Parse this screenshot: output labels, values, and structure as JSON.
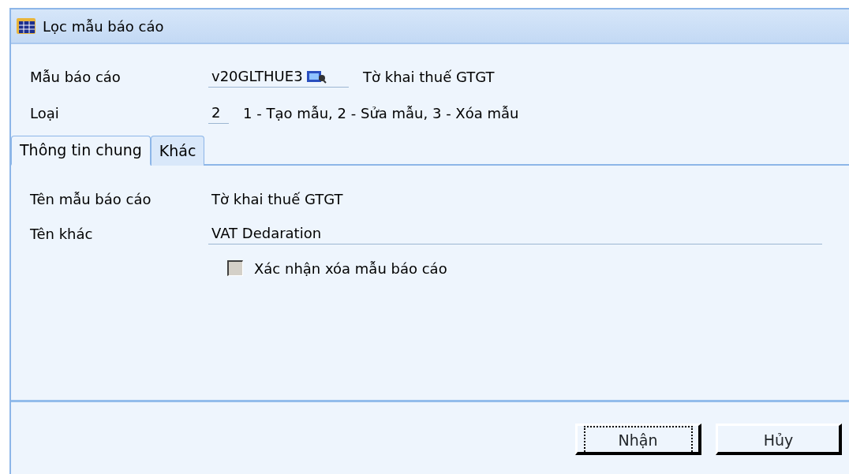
{
  "window": {
    "title": "Lọc mẫu báo cáo"
  },
  "header_fields": [
    {
      "label": "Mẫu báo cáo",
      "value": "v20GLTHUE3",
      "kind": "lookup",
      "note": "Tờ khai thuế GTGT"
    },
    {
      "label": "Loại",
      "value": "2",
      "kind": "short",
      "note": "1 - Tạo mẫu, 2 - Sửa mẫu, 3 - Xóa mẫu"
    }
  ],
  "tabs": [
    {
      "label": "Thông tin chung",
      "selected": true
    },
    {
      "label": "Khác",
      "selected": false
    }
  ],
  "fields": [
    {
      "label": "Tên mẫu báo cáo",
      "value": "Tờ khai thuế GTGT",
      "underlined": false
    },
    {
      "label": "Tên khác",
      "value": "VAT Dedaration",
      "underlined": true
    }
  ],
  "checkbox": {
    "label": "Xác nhận xóa mẫu báo cáo",
    "checked": false
  },
  "buttons": [
    {
      "label": "Nhận",
      "focused": true
    },
    {
      "label": "Hủy",
      "focused": false
    }
  ]
}
